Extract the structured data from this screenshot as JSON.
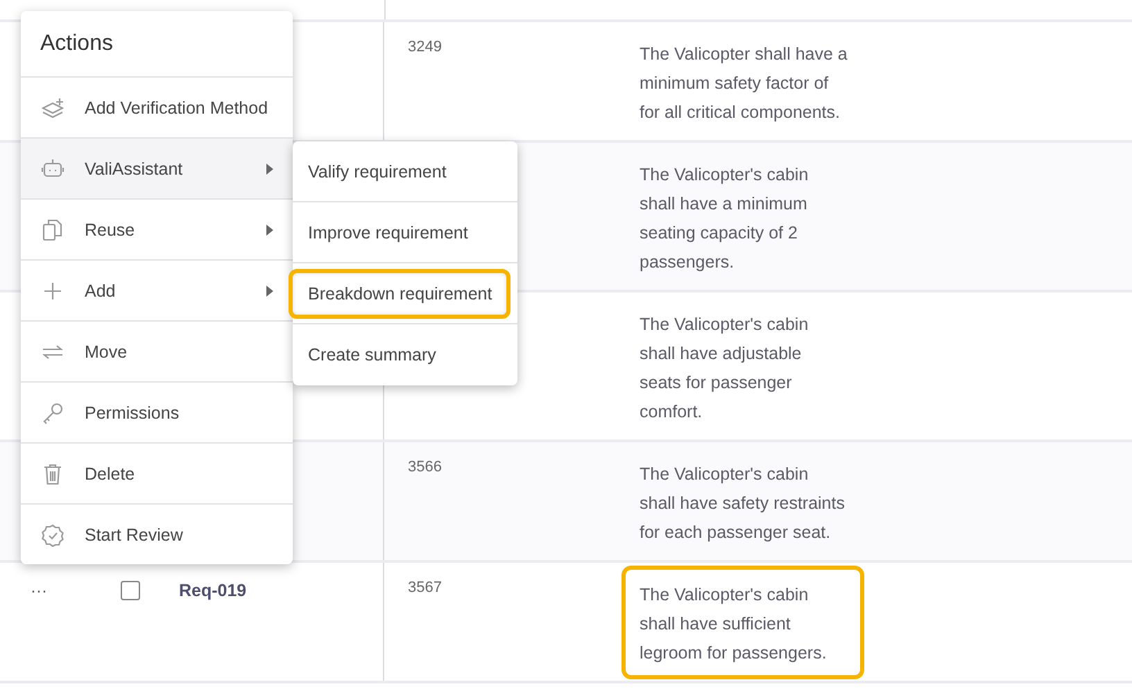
{
  "table": {
    "rows": [
      {
        "number": "3249",
        "description": "The Valicopter shall have a minimum safety factor of for all critical components.",
        "highlighted": false
      },
      {
        "description": "The Valicopter's cabin shall have a minimum seating capacity of 2 passengers.",
        "highlighted": false
      },
      {
        "description": "The Valicopter's cabin shall have adjustable seats for passenger comfort.",
        "highlighted": false
      },
      {
        "number": "3566",
        "description": "The Valicopter's cabin shall have safety restraints for each passenger seat.",
        "highlighted": false
      },
      {
        "actions": "···",
        "checked": false,
        "req_id": "Req-019",
        "number": "3567",
        "description": "The Valicopter's cabin shall have sufficient legroom for passengers.",
        "highlighted": true
      }
    ]
  },
  "actions_menu": {
    "title": "Actions",
    "items": [
      {
        "label": "Add Verification Method",
        "submenu": false,
        "active": false
      },
      {
        "label": "ValiAssistant",
        "submenu": true,
        "active": true
      },
      {
        "label": "Reuse",
        "submenu": true,
        "active": false
      },
      {
        "label": "Add",
        "submenu": true,
        "active": false
      },
      {
        "label": "Move",
        "submenu": false,
        "active": false
      },
      {
        "label": "Permissions",
        "submenu": false,
        "active": false
      },
      {
        "label": "Delete",
        "submenu": false,
        "active": false
      },
      {
        "label": "Start Review",
        "submenu": false,
        "active": false
      }
    ]
  },
  "submenu": {
    "items": [
      {
        "label": "Valify requirement",
        "highlighted": false
      },
      {
        "label": "Improve requirement",
        "highlighted": false
      },
      {
        "label": "Breakdown requirement",
        "highlighted": true
      },
      {
        "label": "Create summary",
        "highlighted": false
      }
    ]
  }
}
